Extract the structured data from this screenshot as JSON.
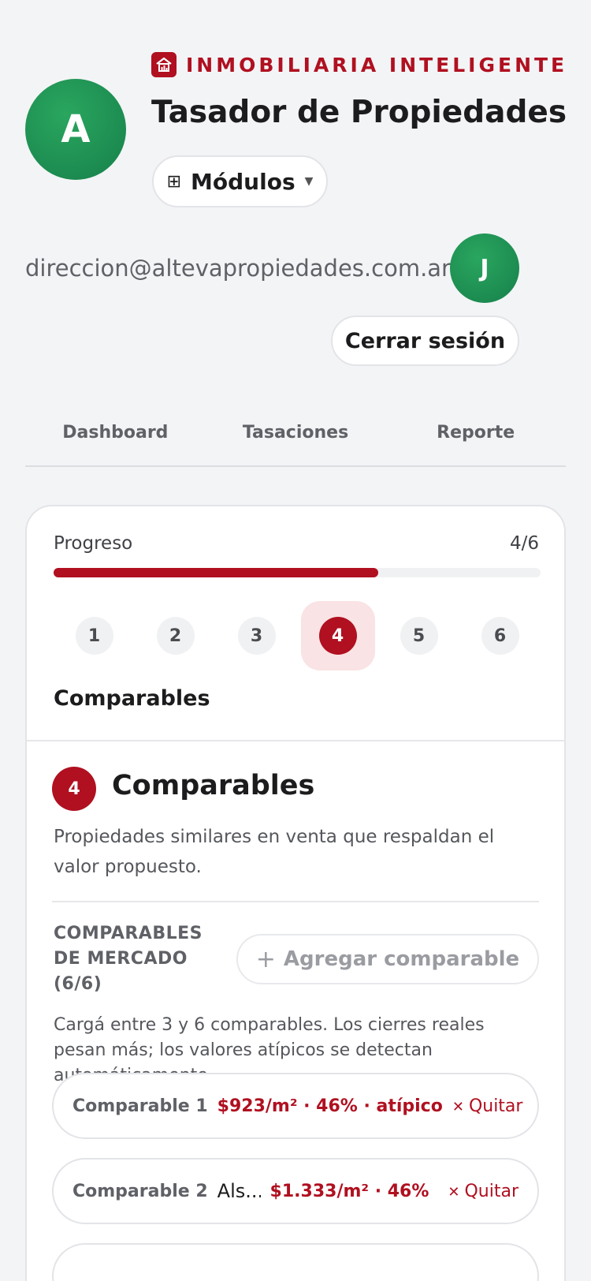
{
  "brand": {
    "name": "INMOBILIARIA INTELIGENTE",
    "icon": "house-chart-icon",
    "color": "#b01020"
  },
  "app": {
    "title": "Tasador de Propiedades",
    "avatar_initial": "A"
  },
  "modules_button": {
    "label": "Módulos",
    "icon": "grid-icon"
  },
  "user": {
    "email": "direccion@altevapropiedades.com.ar",
    "avatar_initial": "J",
    "logout_label": "Cerrar sesión"
  },
  "tabs": [
    {
      "label": "Dashboard"
    },
    {
      "label": "Tasaciones"
    },
    {
      "label": "Reporte"
    }
  ],
  "progress": {
    "label": "Progreso",
    "count": "4/6",
    "fraction": 0.667
  },
  "steps": [
    {
      "label": "1",
      "active": false
    },
    {
      "label": "2",
      "active": false
    },
    {
      "label": "3",
      "active": false
    },
    {
      "label": "4",
      "active": true
    },
    {
      "label": "5",
      "active": false
    },
    {
      "label": "6",
      "active": false
    }
  ],
  "step_title": "Comparables",
  "section": {
    "badge": "4",
    "title": "Comparables",
    "description": "Propiedades similares en venta que respaldan el valor propuesto."
  },
  "market": {
    "label": "COMPARABLES DE MERCADO (6/6)",
    "add_label": "Agregar comparable",
    "help": "Cargá entre 3 y 6 comparables. Los cierres reales pesan más; los valores atípicos se detectan automáticamente."
  },
  "comparables": [
    {
      "name": "Comparable 1",
      "address": "",
      "metric": "$923/m² · 46% · atípico",
      "remove_label": "Quitar"
    },
    {
      "name": "Comparable 2",
      "address": "Als...",
      "metric": "$1.333/m² · 46%",
      "remove_label": "Quitar"
    }
  ]
}
